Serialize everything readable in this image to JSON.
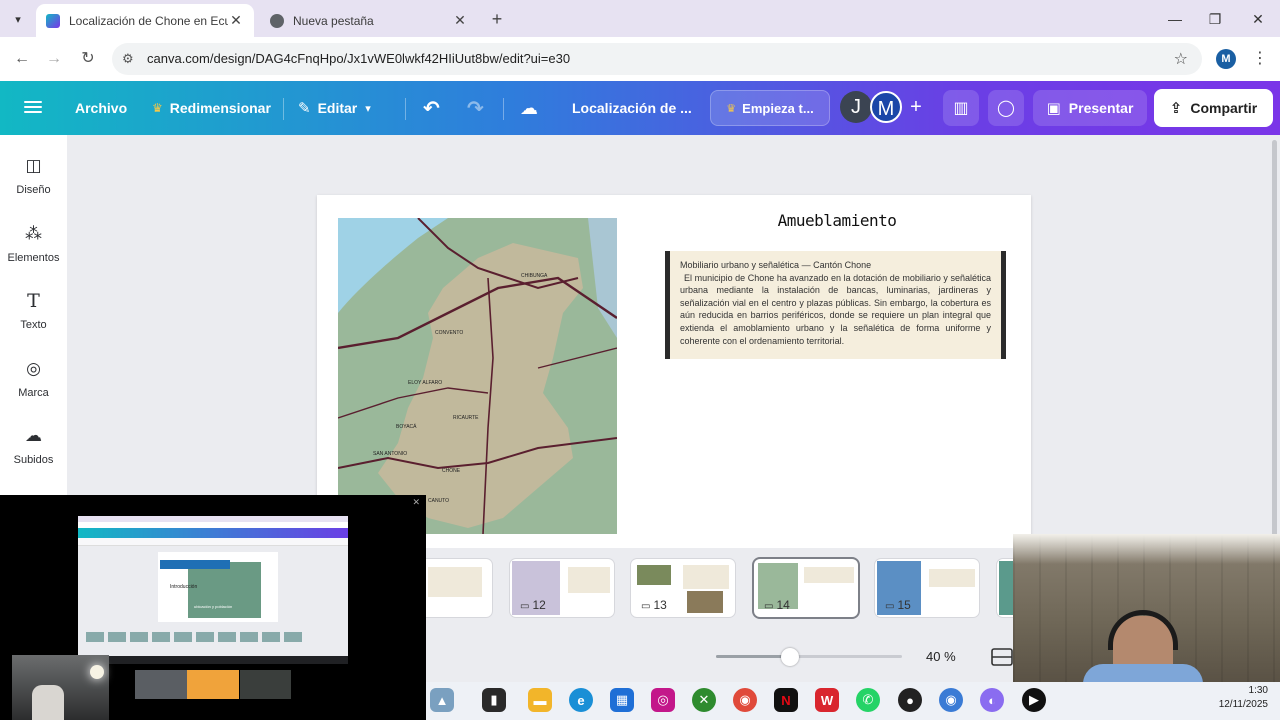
{
  "browser": {
    "tabs": [
      {
        "title": "Localización de Chone en Ecua",
        "active": true
      },
      {
        "title": "Nueva pestaña",
        "active": false
      }
    ],
    "url": "canva.com/design/DAG4cFnqHpo/Jx1vWE0lwkf42HIiUut8bw/edit?ui=e30",
    "profile_initial": "M"
  },
  "header": {
    "file_label": "Archivo",
    "resize_label": "Redimensionar",
    "edit_label": "Editar",
    "doc_title": "Localización de ...",
    "upgrade_label": "Empieza t...",
    "collaborators": [
      "J",
      "M"
    ],
    "present_label": "Presentar",
    "share_label": "Compartir"
  },
  "sidebar": {
    "items": [
      {
        "label": "Diseño",
        "icon": "design-icon"
      },
      {
        "label": "Elementos",
        "icon": "elements-icon"
      },
      {
        "label": "Texto",
        "icon": "text-icon"
      },
      {
        "label": "Marca",
        "icon": "brand-icon"
      },
      {
        "label": "Subidos",
        "icon": "upload-icon"
      }
    ]
  },
  "slide": {
    "title": "Amueblamiento",
    "box_heading": "Mobiliario urbano y señalética — Cantón Chone",
    "box_body": "El municipio de Chone ha avanzado en la dotación de mobiliario y señalética urbana mediante la instalación de bancas, luminarias, jardineras y señalización vial en el centro y plazas públicas. Sin embargo, la cobertura es aún reducida en barrios periféricos, donde se requiere un plan integral que extienda el amoblamiento urbano y la señalética de forma uniforme y coherente con el ordenamiento territorial.",
    "map_labels": [
      "CHIBUNGA",
      "BOYACÁ",
      "ELOY ALFARO",
      "RICAURTE",
      "SAN ANTONIO",
      "CHONE",
      "CANUTO",
      "CONVENTO"
    ]
  },
  "thumbnails": [
    {
      "num": ""
    },
    {
      "num": "12"
    },
    {
      "num": "13"
    },
    {
      "num": "14",
      "selected": true
    },
    {
      "num": "15"
    },
    {
      "num": ""
    }
  ],
  "zoom": {
    "value": "40 %",
    "level": 0.4
  },
  "share_overlay": {
    "mini_text1": "Introducción",
    "mini_text2": "ubicación y población"
  },
  "clock": {
    "time": "1:30",
    "date": "12/11/2025"
  },
  "taskbar_badges": {
    "chrome": "M",
    "whatsapp": "1"
  },
  "colors": {
    "header_start": "#12b8c4",
    "header_end": "#7a35e8",
    "textbox_bg": "#f5eedd",
    "map_land": "#9ab89a",
    "map_water": "#9fd2e6"
  }
}
